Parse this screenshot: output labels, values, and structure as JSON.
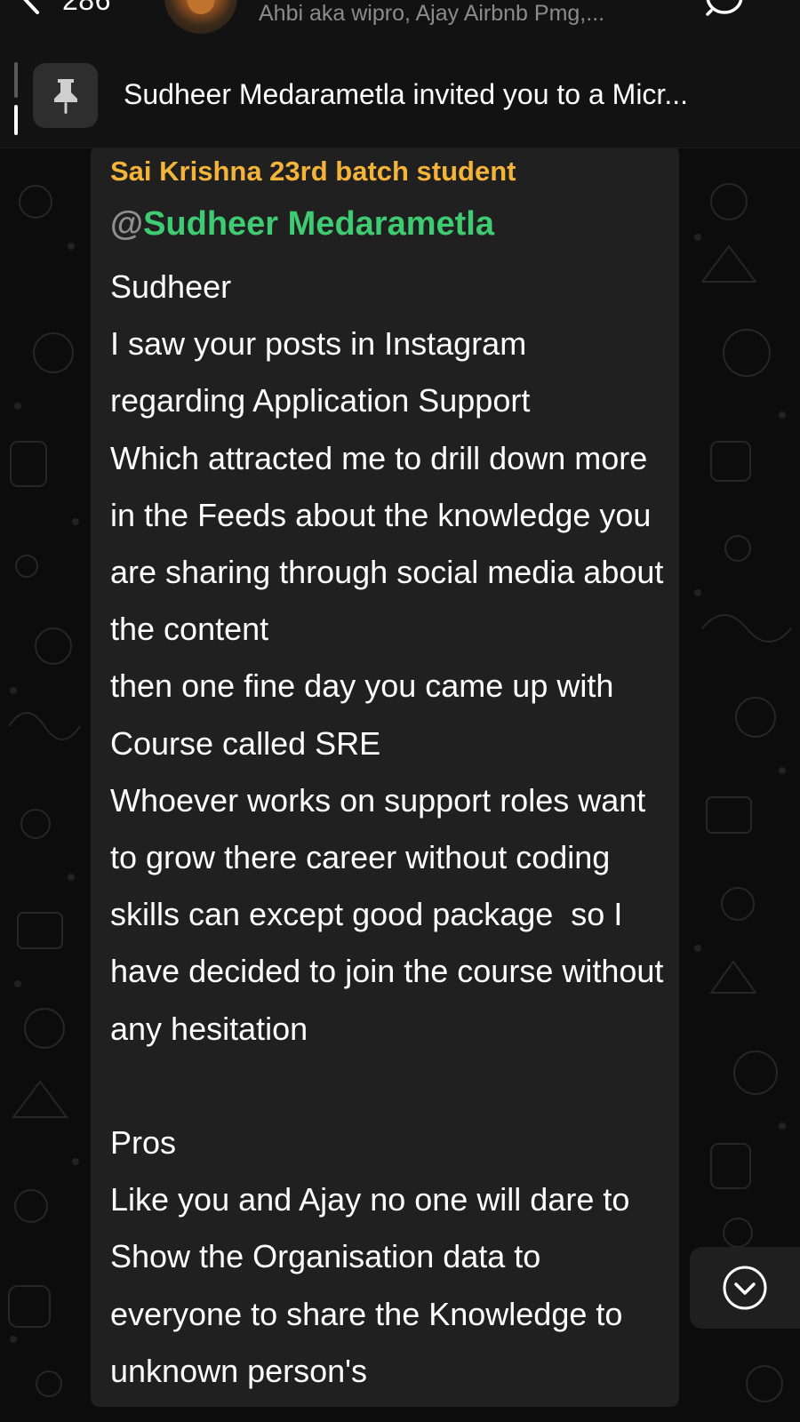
{
  "header": {
    "back_count": "286",
    "members": "Ahbi aka wipro, Ajay Airbnb Pmg,..."
  },
  "pinned": {
    "text": "Sudheer Medarametla invited you to a Micr..."
  },
  "message": {
    "sender": "Sai Krishna 23rd batch student",
    "mention_at": "@",
    "mention_name": "Sudheer Medarametla",
    "body": "Sudheer\nI saw your posts in Instagram regarding Application Support\nWhich attracted me to drill down more in the Feeds about the knowledge you are sharing through social media about the content\nthen one fine day you came up with Course called SRE\nWhoever works on support roles want to grow there career without coding skills can except good package  so I have decided to join the course without any hesitation\n\nPros\nLike you and Ajay no one will dare to Show the Organisation data to everyone to share the Knowledge to unknown person's"
  },
  "colors": {
    "sender": "#f4b43a",
    "mention": "#3fcb72",
    "bubble": "#202020",
    "background": "#0c0c0c"
  },
  "icons": {
    "back": "chevron-left-icon",
    "pin": "pin-icon",
    "scroll_down": "chevron-down-circle-icon",
    "video_call": "video-call-icon"
  }
}
